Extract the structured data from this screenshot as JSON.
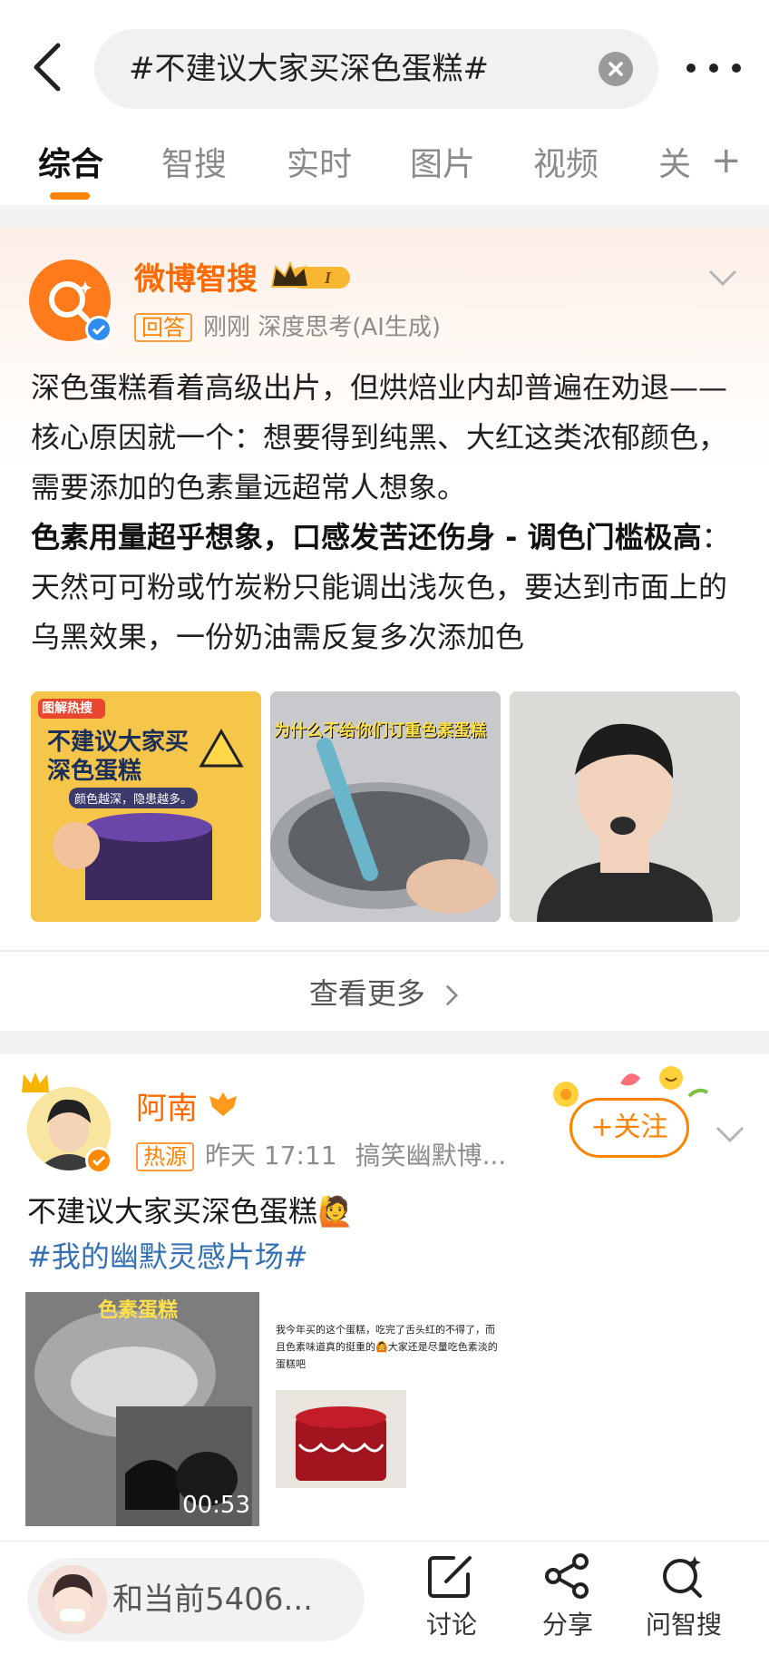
{
  "header": {
    "back_icon": "back-arrow-icon",
    "search_value": "#不建议大家买深色蛋糕#",
    "more_icon": "more-dots-icon"
  },
  "tabs": [
    {
      "label": "综合",
      "active": true
    },
    {
      "label": "智搜"
    },
    {
      "label": "实时"
    },
    {
      "label": "图片"
    },
    {
      "label": "视频"
    },
    {
      "label": "关"
    }
  ],
  "tabs_add": "+",
  "ai_card": {
    "author": "微博智搜",
    "level_badge": "I",
    "tag": "回答",
    "meta": "刚刚 深度思考(AI生成)",
    "para1": "深色蛋糕看着高级出片，但烘焙业内却普遍在劝退——核心原因就一个：想要得到纯黑、大红这类浓郁颜色，需要添加的色素量远超常人想象。",
    "bold": "色素用量超乎想象，口感发苦还伤身 - 调色门槛极高",
    "para2": "：天然可可粉或竹炭粉只能调出浅灰色，要达到市面上的乌黑效果，一份奶油需反复多次添加色",
    "img1_tag": "图解热搜",
    "img1_title": "不建议大家买深色蛋糕",
    "img1_sub": "颜色越深，隐患越多。",
    "img2_caption": "为什么不给你们订重色素蛋糕",
    "see_more": "查看更多"
  },
  "post": {
    "author": "阿南",
    "tag": "热源",
    "time": "昨天 17:11",
    "source": "搞笑幽默博...",
    "follow": "+关注",
    "text": "不建议大家买深色蛋糕🙋",
    "hashtag": "#我的幽默灵感片场#",
    "video_tag": "色素蛋糕",
    "video_duration": "00:53",
    "img_text": "我今年买的这个蛋糕，吃完了舌头红的不得了，而且色素味道真的挺重的🙆大家还是尽量吃色素淡的蛋糕吧"
  },
  "bottom": {
    "input_placeholder": "和当前5406...",
    "actions": [
      {
        "label": "讨论",
        "icon": "edit-icon"
      },
      {
        "label": "分享",
        "icon": "share-icon"
      },
      {
        "label": "问智搜",
        "icon": "ai-search-icon"
      }
    ]
  },
  "colors": {
    "accent": "#ff8200",
    "link": "#3570b5"
  }
}
